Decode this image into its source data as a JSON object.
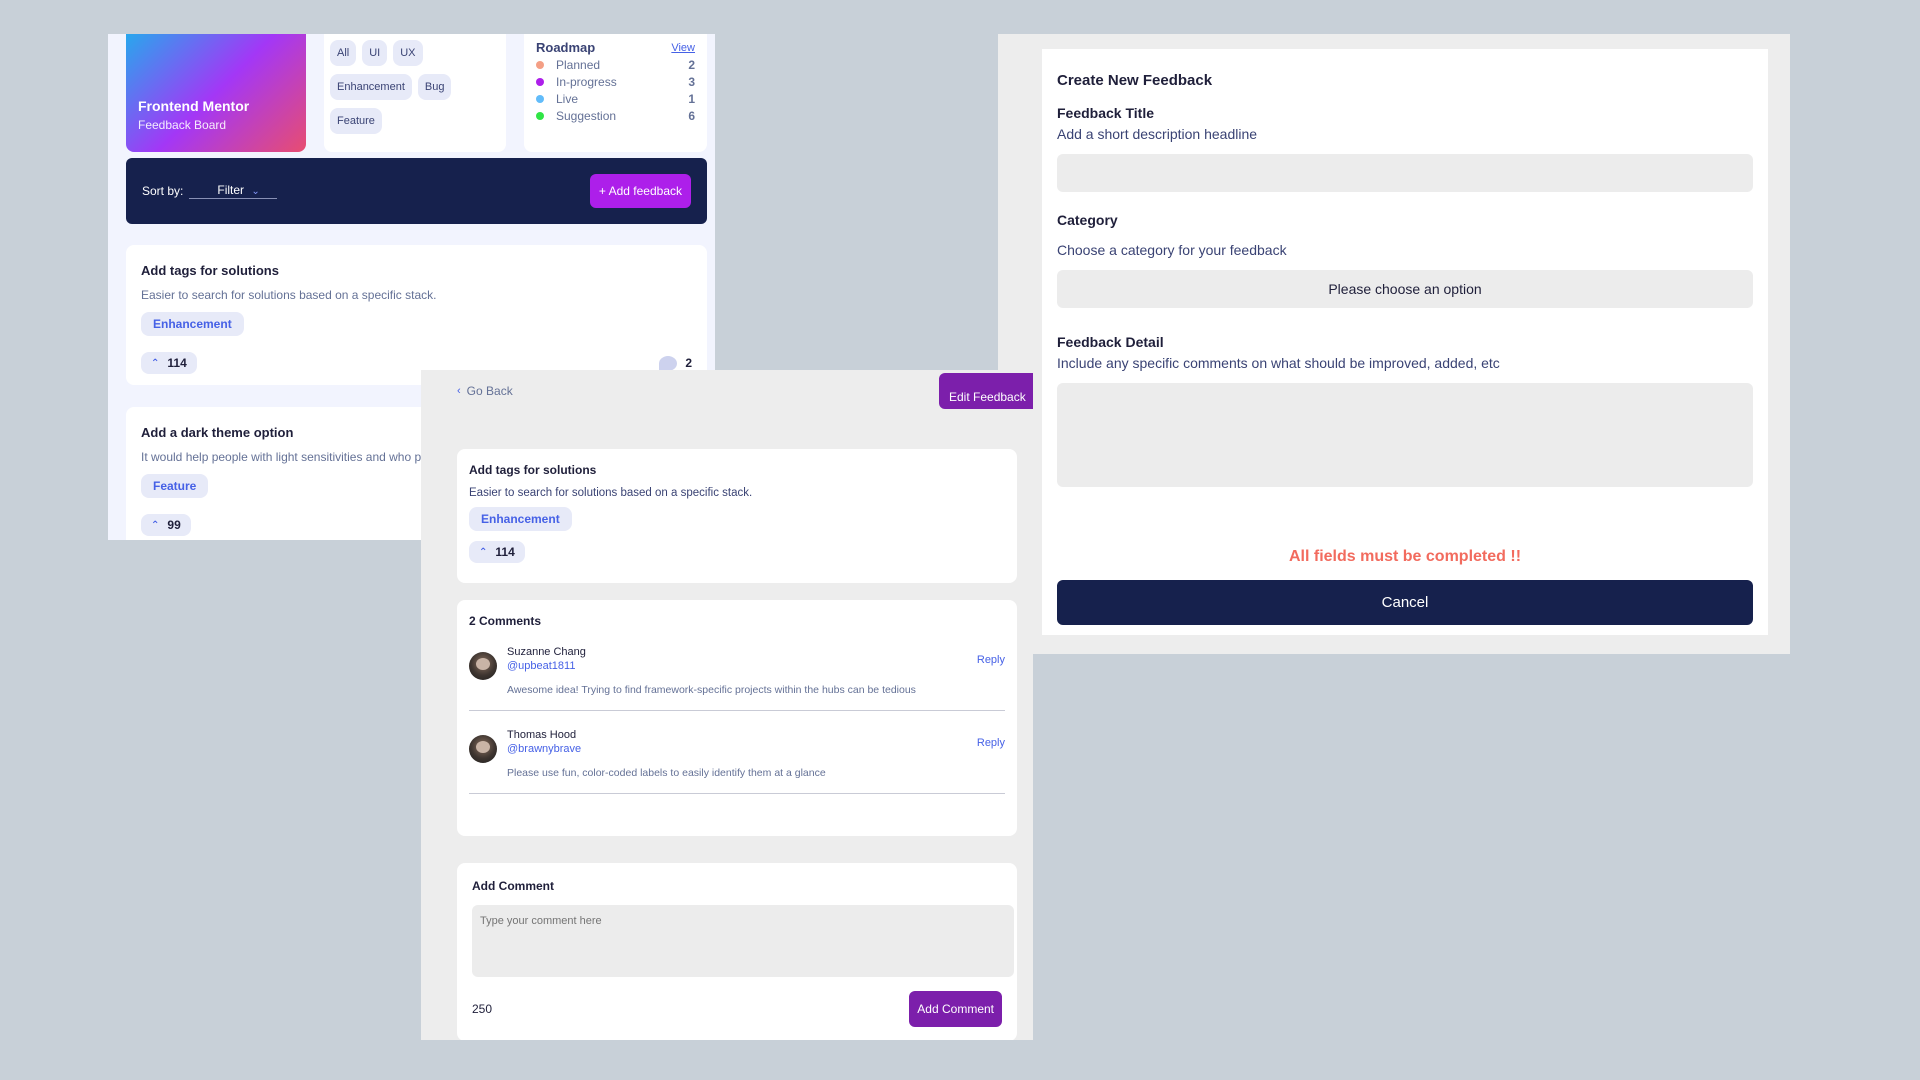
{
  "board": {
    "brand": {
      "title": "Frontend Mentor",
      "subtitle": "Feedback Board"
    },
    "filters": [
      "All",
      "UI",
      "UX",
      "Enhancement",
      "Bug",
      "Feature"
    ],
    "roadmap": {
      "title": "Roadmap",
      "view_link": "View",
      "items": [
        {
          "label": "Planned",
          "count": "2",
          "color": "#f49f85"
        },
        {
          "label": "In-progress",
          "count": "3",
          "color": "#ad1fea"
        },
        {
          "label": "Live",
          "count": "1",
          "color": "#62bcfa"
        },
        {
          "label": "Suggestion",
          "count": "6",
          "color": "#30e545"
        }
      ]
    },
    "sortbar": {
      "label": "Sort by:",
      "filter": "Filter",
      "add_button": "+ Add feedback"
    },
    "suggestions": [
      {
        "title": "Add tags for solutions",
        "description": "Easier to search for solutions based on a specific stack.",
        "category": "Enhancement",
        "upvotes": "114",
        "comments": "2"
      },
      {
        "title": "Add a dark theme option",
        "description": "It would help people with light sensitivities and who prefer dark mode.",
        "category": "Feature",
        "upvotes": "99",
        "comments": ""
      }
    ]
  },
  "detail": {
    "go_back": "Go Back",
    "edit_button": "Edit Feedback",
    "feedback": {
      "title": "Add tags for solutions",
      "description": "Easier to search for solutions based on a specific stack.",
      "category": "Enhancement",
      "upvotes": "114"
    },
    "comments_heading": "2 Comments",
    "comments": [
      {
        "name": "Suzanne Chang",
        "handle": "@upbeat1811",
        "text": "Awesome idea! Trying to find framework-specific projects within the hubs can be tedious",
        "reply": "Reply"
      },
      {
        "name": "Thomas Hood",
        "handle": "@brawnybrave",
        "text": "Please use fun, color-coded labels to easily identify them at a glance",
        "reply": "Reply"
      }
    ],
    "add_comment": {
      "title": "Add Comment",
      "placeholder": "Type your comment here",
      "chars_left": "250",
      "button": "Add Comment"
    }
  },
  "create": {
    "title": "Create New Feedback",
    "title_label": "Feedback Title",
    "title_hint": "Add a short description headline",
    "category_label": "Category",
    "category_hint": "Choose a category for your feedback",
    "category_placeholder": "Please choose an option",
    "detail_label": "Feedback Detail",
    "detail_hint": "Include any specific comments on what should be improved, added, etc",
    "error": "All fields must be completed !!",
    "cancel_button": "Cancel"
  }
}
